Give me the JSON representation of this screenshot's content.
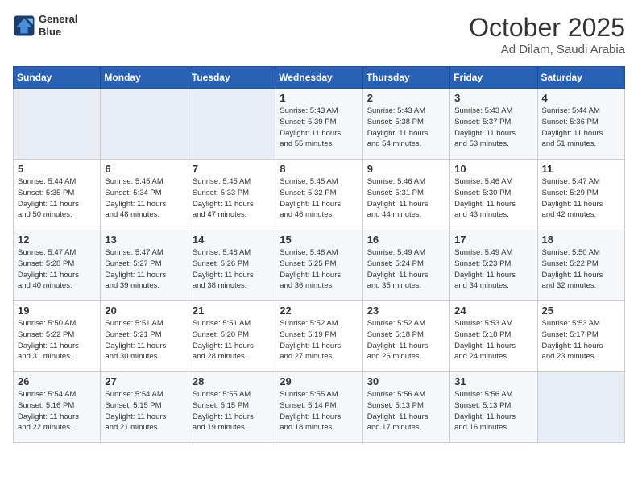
{
  "header": {
    "logo_line1": "General",
    "logo_line2": "Blue",
    "month": "October 2025",
    "location": "Ad Dilam, Saudi Arabia"
  },
  "days_of_week": [
    "Sunday",
    "Monday",
    "Tuesday",
    "Wednesday",
    "Thursday",
    "Friday",
    "Saturday"
  ],
  "weeks": [
    [
      {
        "day": "",
        "info": ""
      },
      {
        "day": "",
        "info": ""
      },
      {
        "day": "",
        "info": ""
      },
      {
        "day": "1",
        "info": "Sunrise: 5:43 AM\nSunset: 5:39 PM\nDaylight: 11 hours\nand 55 minutes."
      },
      {
        "day": "2",
        "info": "Sunrise: 5:43 AM\nSunset: 5:38 PM\nDaylight: 11 hours\nand 54 minutes."
      },
      {
        "day": "3",
        "info": "Sunrise: 5:43 AM\nSunset: 5:37 PM\nDaylight: 11 hours\nand 53 minutes."
      },
      {
        "day": "4",
        "info": "Sunrise: 5:44 AM\nSunset: 5:36 PM\nDaylight: 11 hours\nand 51 minutes."
      }
    ],
    [
      {
        "day": "5",
        "info": "Sunrise: 5:44 AM\nSunset: 5:35 PM\nDaylight: 11 hours\nand 50 minutes."
      },
      {
        "day": "6",
        "info": "Sunrise: 5:45 AM\nSunset: 5:34 PM\nDaylight: 11 hours\nand 48 minutes."
      },
      {
        "day": "7",
        "info": "Sunrise: 5:45 AM\nSunset: 5:33 PM\nDaylight: 11 hours\nand 47 minutes."
      },
      {
        "day": "8",
        "info": "Sunrise: 5:45 AM\nSunset: 5:32 PM\nDaylight: 11 hours\nand 46 minutes."
      },
      {
        "day": "9",
        "info": "Sunrise: 5:46 AM\nSunset: 5:31 PM\nDaylight: 11 hours\nand 44 minutes."
      },
      {
        "day": "10",
        "info": "Sunrise: 5:46 AM\nSunset: 5:30 PM\nDaylight: 11 hours\nand 43 minutes."
      },
      {
        "day": "11",
        "info": "Sunrise: 5:47 AM\nSunset: 5:29 PM\nDaylight: 11 hours\nand 42 minutes."
      }
    ],
    [
      {
        "day": "12",
        "info": "Sunrise: 5:47 AM\nSunset: 5:28 PM\nDaylight: 11 hours\nand 40 minutes."
      },
      {
        "day": "13",
        "info": "Sunrise: 5:47 AM\nSunset: 5:27 PM\nDaylight: 11 hours\nand 39 minutes."
      },
      {
        "day": "14",
        "info": "Sunrise: 5:48 AM\nSunset: 5:26 PM\nDaylight: 11 hours\nand 38 minutes."
      },
      {
        "day": "15",
        "info": "Sunrise: 5:48 AM\nSunset: 5:25 PM\nDaylight: 11 hours\nand 36 minutes."
      },
      {
        "day": "16",
        "info": "Sunrise: 5:49 AM\nSunset: 5:24 PM\nDaylight: 11 hours\nand 35 minutes."
      },
      {
        "day": "17",
        "info": "Sunrise: 5:49 AM\nSunset: 5:23 PM\nDaylight: 11 hours\nand 34 minutes."
      },
      {
        "day": "18",
        "info": "Sunrise: 5:50 AM\nSunset: 5:22 PM\nDaylight: 11 hours\nand 32 minutes."
      }
    ],
    [
      {
        "day": "19",
        "info": "Sunrise: 5:50 AM\nSunset: 5:22 PM\nDaylight: 11 hours\nand 31 minutes."
      },
      {
        "day": "20",
        "info": "Sunrise: 5:51 AM\nSunset: 5:21 PM\nDaylight: 11 hours\nand 30 minutes."
      },
      {
        "day": "21",
        "info": "Sunrise: 5:51 AM\nSunset: 5:20 PM\nDaylight: 11 hours\nand 28 minutes."
      },
      {
        "day": "22",
        "info": "Sunrise: 5:52 AM\nSunset: 5:19 PM\nDaylight: 11 hours\nand 27 minutes."
      },
      {
        "day": "23",
        "info": "Sunrise: 5:52 AM\nSunset: 5:18 PM\nDaylight: 11 hours\nand 26 minutes."
      },
      {
        "day": "24",
        "info": "Sunrise: 5:53 AM\nSunset: 5:18 PM\nDaylight: 11 hours\nand 24 minutes."
      },
      {
        "day": "25",
        "info": "Sunrise: 5:53 AM\nSunset: 5:17 PM\nDaylight: 11 hours\nand 23 minutes."
      }
    ],
    [
      {
        "day": "26",
        "info": "Sunrise: 5:54 AM\nSunset: 5:16 PM\nDaylight: 11 hours\nand 22 minutes."
      },
      {
        "day": "27",
        "info": "Sunrise: 5:54 AM\nSunset: 5:15 PM\nDaylight: 11 hours\nand 21 minutes."
      },
      {
        "day": "28",
        "info": "Sunrise: 5:55 AM\nSunset: 5:15 PM\nDaylight: 11 hours\nand 19 minutes."
      },
      {
        "day": "29",
        "info": "Sunrise: 5:55 AM\nSunset: 5:14 PM\nDaylight: 11 hours\nand 18 minutes."
      },
      {
        "day": "30",
        "info": "Sunrise: 5:56 AM\nSunset: 5:13 PM\nDaylight: 11 hours\nand 17 minutes."
      },
      {
        "day": "31",
        "info": "Sunrise: 5:56 AM\nSunset: 5:13 PM\nDaylight: 11 hours\nand 16 minutes."
      },
      {
        "day": "",
        "info": ""
      }
    ]
  ]
}
